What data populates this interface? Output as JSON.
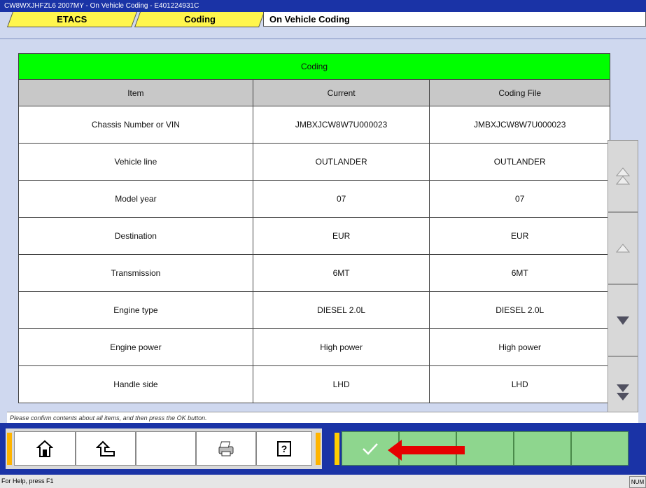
{
  "window": {
    "title": "CW8WXJHFZL6 2007MY   -  On Vehicle Coding  -  E401224931C"
  },
  "tabs": [
    {
      "label": "ETACS"
    },
    {
      "label": "Coding"
    },
    {
      "label": "On Vehicle Coding"
    }
  ],
  "table": {
    "section_title": "Coding",
    "columns": [
      "Item",
      "Current",
      "Coding File"
    ],
    "rows": [
      [
        "Chassis Number or VIN",
        "JMBXJCW8W7U000023",
        "JMBXJCW8W7U000023"
      ],
      [
        "Vehicle line",
        "OUTLANDER",
        "OUTLANDER"
      ],
      [
        "Model year",
        "07",
        "07"
      ],
      [
        "Destination",
        "EUR",
        "EUR"
      ],
      [
        "Transmission",
        "6MT",
        "6MT"
      ],
      [
        "Engine type",
        "DIESEL 2.0L",
        "DIESEL 2.0L"
      ],
      [
        "Engine power",
        "High power",
        "High power"
      ],
      [
        "Handle side",
        "LHD",
        "LHD"
      ]
    ]
  },
  "status_message": "Please confirm contents about all items, and then press the OK button.",
  "toolbar": {
    "icons": [
      "home-icon",
      "back-icon",
      "printer-icon",
      "help-icon",
      "ok-check-icon"
    ],
    "accent_color": "#1a33a6",
    "ok_color": "#8ed68e",
    "arrow_color": "#e60000"
  },
  "statusbar": {
    "help": "For Help, press F1",
    "indicator": "NUM"
  }
}
